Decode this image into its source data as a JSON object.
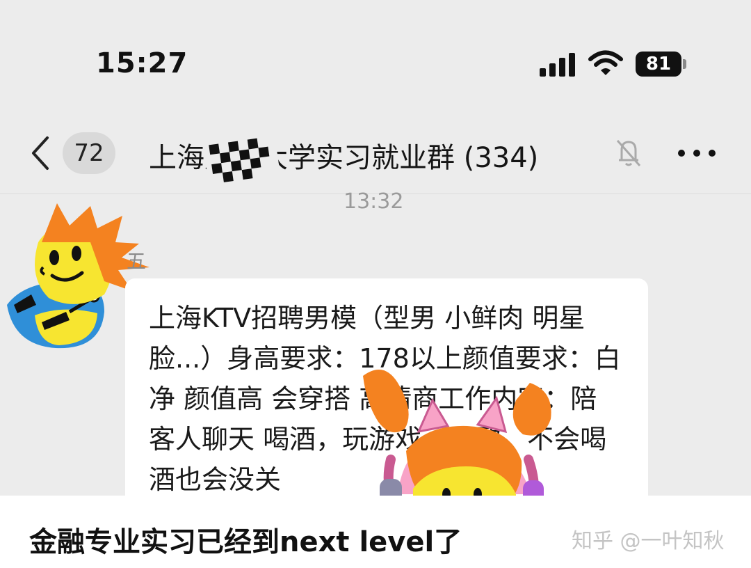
{
  "status_bar": {
    "time": "15:27",
    "battery": "81"
  },
  "header": {
    "unread_count": "72",
    "title": "上海财经大学实习就业群 (334)"
  },
  "message": {
    "timestamp": "13:32",
    "sender": "五",
    "text": "上海KTV招聘男模（型男 小鲜肉 明星脸...）身高要求：178以上颜值要求：白净 颜值高 会穿搭 高情商工作内容：陪客人聊天 喝酒，玩游戏，唱歌，不会喝酒也会没关"
  },
  "caption": "金融专业实习已经到next level了",
  "watermark": "知乎 @一叶知秋",
  "colors": {
    "background": "#ececec",
    "bubble": "#ffffff",
    "badge": "#d9d9d9"
  }
}
